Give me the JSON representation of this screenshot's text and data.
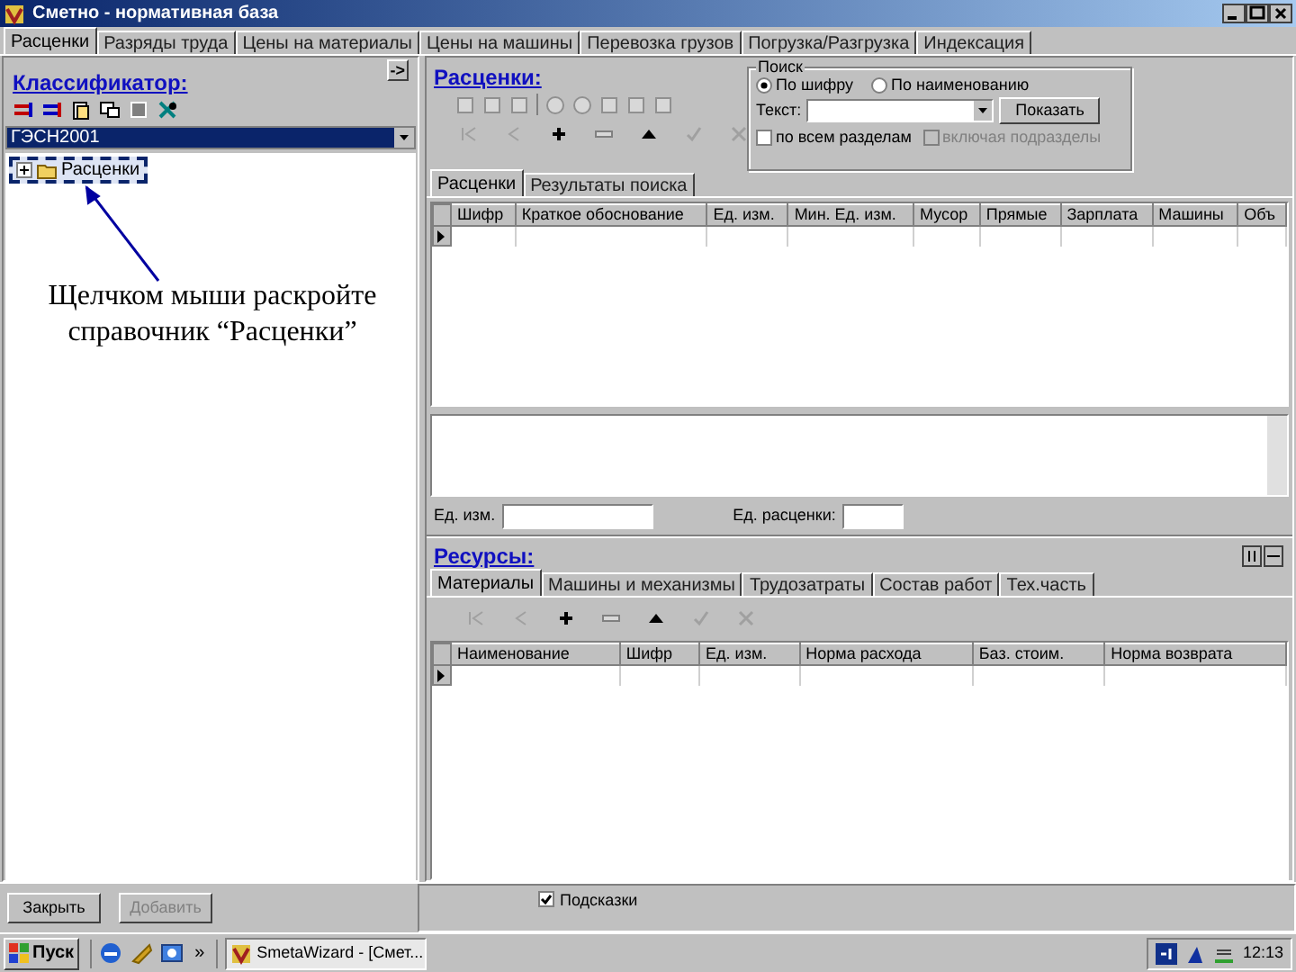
{
  "window": {
    "title": "Сметно - нормативная база"
  },
  "tabs": [
    {
      "label": "Расценки",
      "selected": true
    },
    {
      "label": "Разряды труда",
      "selected": false
    },
    {
      "label": "Цены на материалы",
      "selected": false
    },
    {
      "label": "Цены на машины",
      "selected": false
    },
    {
      "label": "Перевозка грузов",
      "selected": false
    },
    {
      "label": "Погрузка/Разгрузка",
      "selected": false
    },
    {
      "label": "Индексация",
      "selected": false
    }
  ],
  "classifier": {
    "title": "Классификатор:",
    "collapse_button": "->",
    "dropdown_value": "ГЭСН2001",
    "tree": [
      {
        "label": "Расценки",
        "expanded": false,
        "selected": true
      }
    ]
  },
  "rates": {
    "title": "Расценки:",
    "search": {
      "title": "Поиск",
      "options": [
        {
          "label": "По шифру",
          "selected": true
        },
        {
          "label": "По наименованию",
          "selected": false
        }
      ],
      "text_label": "Текст:",
      "show_button": "Показать",
      "checkboxes": [
        {
          "label": "по всем разделам",
          "checked": false,
          "disabled": false
        },
        {
          "label": "включая подразделы",
          "checked": false,
          "disabled": true
        }
      ]
    },
    "subtabs": [
      {
        "label": "Расценки",
        "selected": true
      },
      {
        "label": "Результаты поиска",
        "selected": false
      }
    ],
    "columns": [
      "Шифр",
      "Краткое обоснование",
      "Ед. изм.",
      "Мин. Ед. изм.",
      "Мусор",
      "Прямые",
      "Зарплата",
      "Машины",
      "Объ"
    ]
  },
  "unit_fields": [
    {
      "label": "Ед. изм."
    },
    {
      "label": "Ед. расценки:"
    }
  ],
  "resources": {
    "title": "Ресурсы:",
    "tabs": [
      {
        "label": "Материалы",
        "selected": true
      },
      {
        "label": "Машины и механизмы",
        "selected": false
      },
      {
        "label": "Трудозатраты",
        "selected": false
      },
      {
        "label": "Состав работ",
        "selected": false
      },
      {
        "label": "Тех.часть",
        "selected": false
      }
    ],
    "columns": [
      "Наименование",
      "Шифр",
      "Ед. изм.",
      "Норма расхода",
      "Баз. стоим.",
      "Норма возврата"
    ]
  },
  "footer": {
    "buttons": [
      {
        "label": "Закрыть",
        "disabled": false
      },
      {
        "label": "Добавить",
        "disabled": true
      }
    ],
    "hints": {
      "label": "Подсказки",
      "checked": true
    }
  },
  "annotation": {
    "text": "Щелчком мыши раскройте справочник “Расценки”"
  },
  "taskbar": {
    "start": "Пуск",
    "more": "»",
    "tasks": [
      {
        "label": "SmetaWizard - [Смет...",
        "selected": true
      }
    ],
    "clock": "12:13"
  }
}
